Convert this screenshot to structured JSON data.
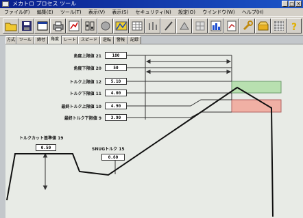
{
  "titlebar": {
    "title": "メカトロ プロセス ツール",
    "buttons": [
      "_",
      "□",
      "X"
    ]
  },
  "menubar": {
    "items": [
      "ファイル(F)",
      "編集(E)",
      "ツール(T)",
      "表示(V)",
      "表示(S)",
      "セキュリティ(N)",
      "設定(O)",
      "ウインドウ(W)",
      "ヘルプ(H)"
    ]
  },
  "toolbar": {
    "icons": [
      "open-folder-icon",
      "save-disk-icon",
      "window-icon",
      "print-icon",
      "chart-icon",
      "settings-icon",
      "record-icon",
      "graph-icon",
      "table-icon",
      "bars-icon",
      "pen-icon",
      "triangle-icon",
      "grid-icon",
      "bar-chart-icon",
      "document-chart-icon",
      "wrench-icon",
      "open-box-icon",
      "pattern-icon",
      "export-icon",
      "help-icon"
    ]
  },
  "tabs": [
    "方式",
    "ツール",
    "締付",
    "角度",
    "レート",
    "スピード",
    "逆転",
    "警報",
    "記録"
  ],
  "active_tab": 3,
  "params": [
    {
      "label": "角度上限値 21",
      "value": "180"
    },
    {
      "label": "角度下限値 20",
      "value": "50"
    },
    {
      "label": "トルク上限値 12",
      "value": "5.10"
    },
    {
      "label": "トルク下限値 11",
      "value": "4.00"
    },
    {
      "label": "最終トルク上限値 10",
      "value": "4.90"
    },
    {
      "label": "最終トルク下限値 9",
      "value": "3.90"
    }
  ],
  "cutoff": {
    "label": "トルクカット基準値 19",
    "value": "0.50"
  },
  "snug": {
    "label": "SNUGトルク 15",
    "value": "0.60"
  },
  "colors": {
    "upper_zone": "#b8e0b0",
    "lower_zone": "#f0b0a4",
    "panel_bg": "#e8ebe6",
    "curve": "#111111"
  }
}
